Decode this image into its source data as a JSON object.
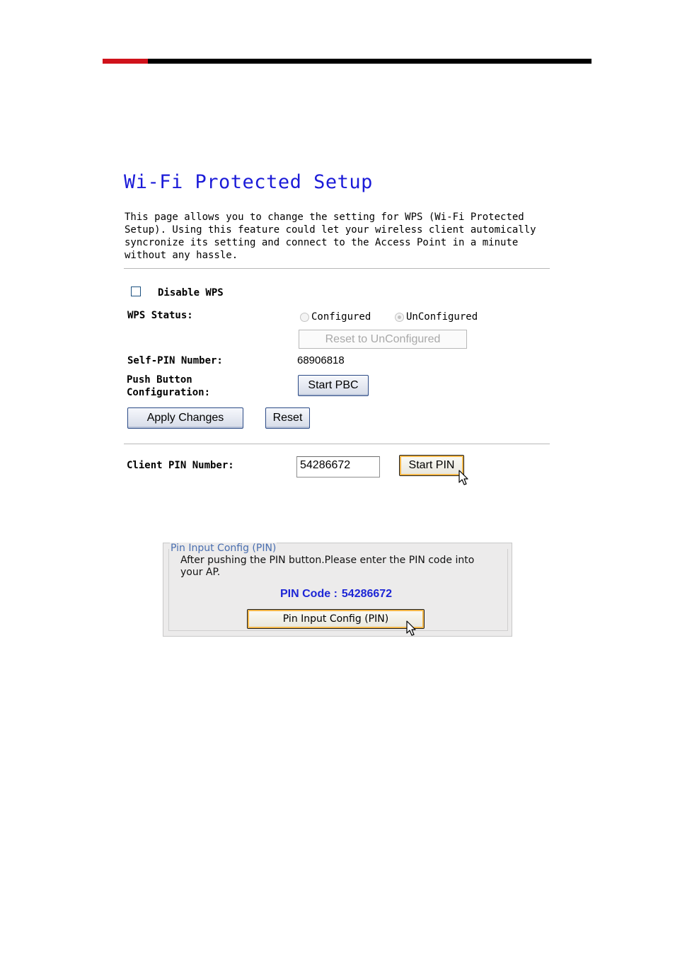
{
  "page": {
    "title": "Wi-Fi Protected Setup",
    "intro": "This page allows you to change the setting for WPS (Wi-Fi Protected\nSetup). Using this feature could let your wireless client automically\nsyncronize its setting and connect to the Access Point in a minute\nwithout any hassle."
  },
  "wps": {
    "disable_label": "Disable WPS",
    "disable_checked": false,
    "status_label": "WPS Status:",
    "status_options": [
      "Configured",
      "UnConfigured"
    ],
    "status_selected": "UnConfigured",
    "reset_unconfigured_label": "Reset to UnConfigured",
    "self_pin_label": "Self-PIN Number:",
    "self_pin_value": "68906818",
    "pbc_label_line1": "Push Button",
    "pbc_label_line2": "Configuration:",
    "start_pbc_label": "Start PBC",
    "apply_label": "Apply Changes",
    "reset_label": "Reset",
    "client_pin_label": "Client PIN Number:",
    "client_pin_value": "54286672",
    "start_pin_label": "Start PIN"
  },
  "pin_dialog": {
    "legend": "Pin Input Config (PIN)",
    "description": "After pushing the PIN button.Please enter the PIN code into your AP.",
    "pin_code_label": "PIN Code :",
    "pin_code_value": "54286672",
    "button_label": "Pin Input Config (PIN)"
  },
  "colors": {
    "title": "#1b1bd8",
    "header_accent": "#d0121b",
    "pin_code": "#1d26d6"
  }
}
